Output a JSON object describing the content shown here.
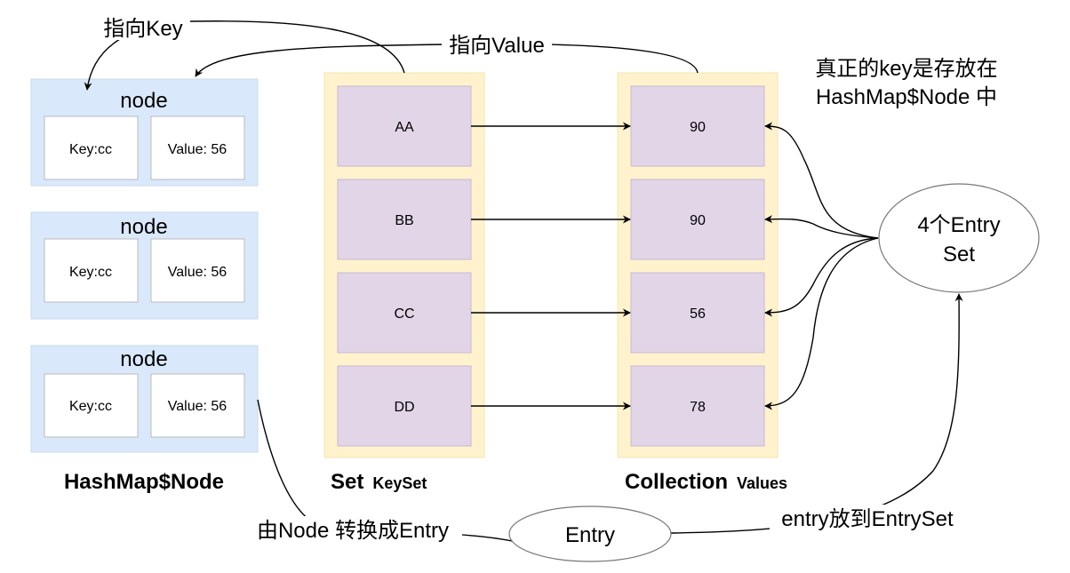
{
  "nodes": [
    {
      "title": "node",
      "key": "Key:cc",
      "value": "Value: 56"
    },
    {
      "title": "node",
      "key": "Key:cc",
      "value": "Value: 56"
    },
    {
      "title": "node",
      "key": "Key:cc",
      "value": "Value: 56"
    }
  ],
  "keyset": [
    "AA",
    "BB",
    "CC",
    "DD"
  ],
  "values": [
    "90",
    "90",
    "56",
    "78"
  ],
  "captions": {
    "hashmap_node": "HashMap$Node",
    "set_main": "Set",
    "set_sub": "KeySet",
    "collection_main": "Collection",
    "collection_sub": "Values"
  },
  "labels": {
    "point_key": "指向Key",
    "point_value": "指向Value",
    "note_line1": "真正的key是存放在",
    "note_line2": "HashMap$Node 中",
    "node_to_entry": "由Node 转换成Entry",
    "entry_to_set": "entry放到EntrySet"
  },
  "ellipses": {
    "entryset_line1": "4个Entry",
    "entryset_line2": "Set",
    "entry": "Entry"
  },
  "colors": {
    "node_bg": "#dae8fc",
    "node_border": "#c9d8ef",
    "set_bg": "#fff2cc",
    "item_bg": "#e1d5e7",
    "item_border": "#c8b8d6"
  }
}
